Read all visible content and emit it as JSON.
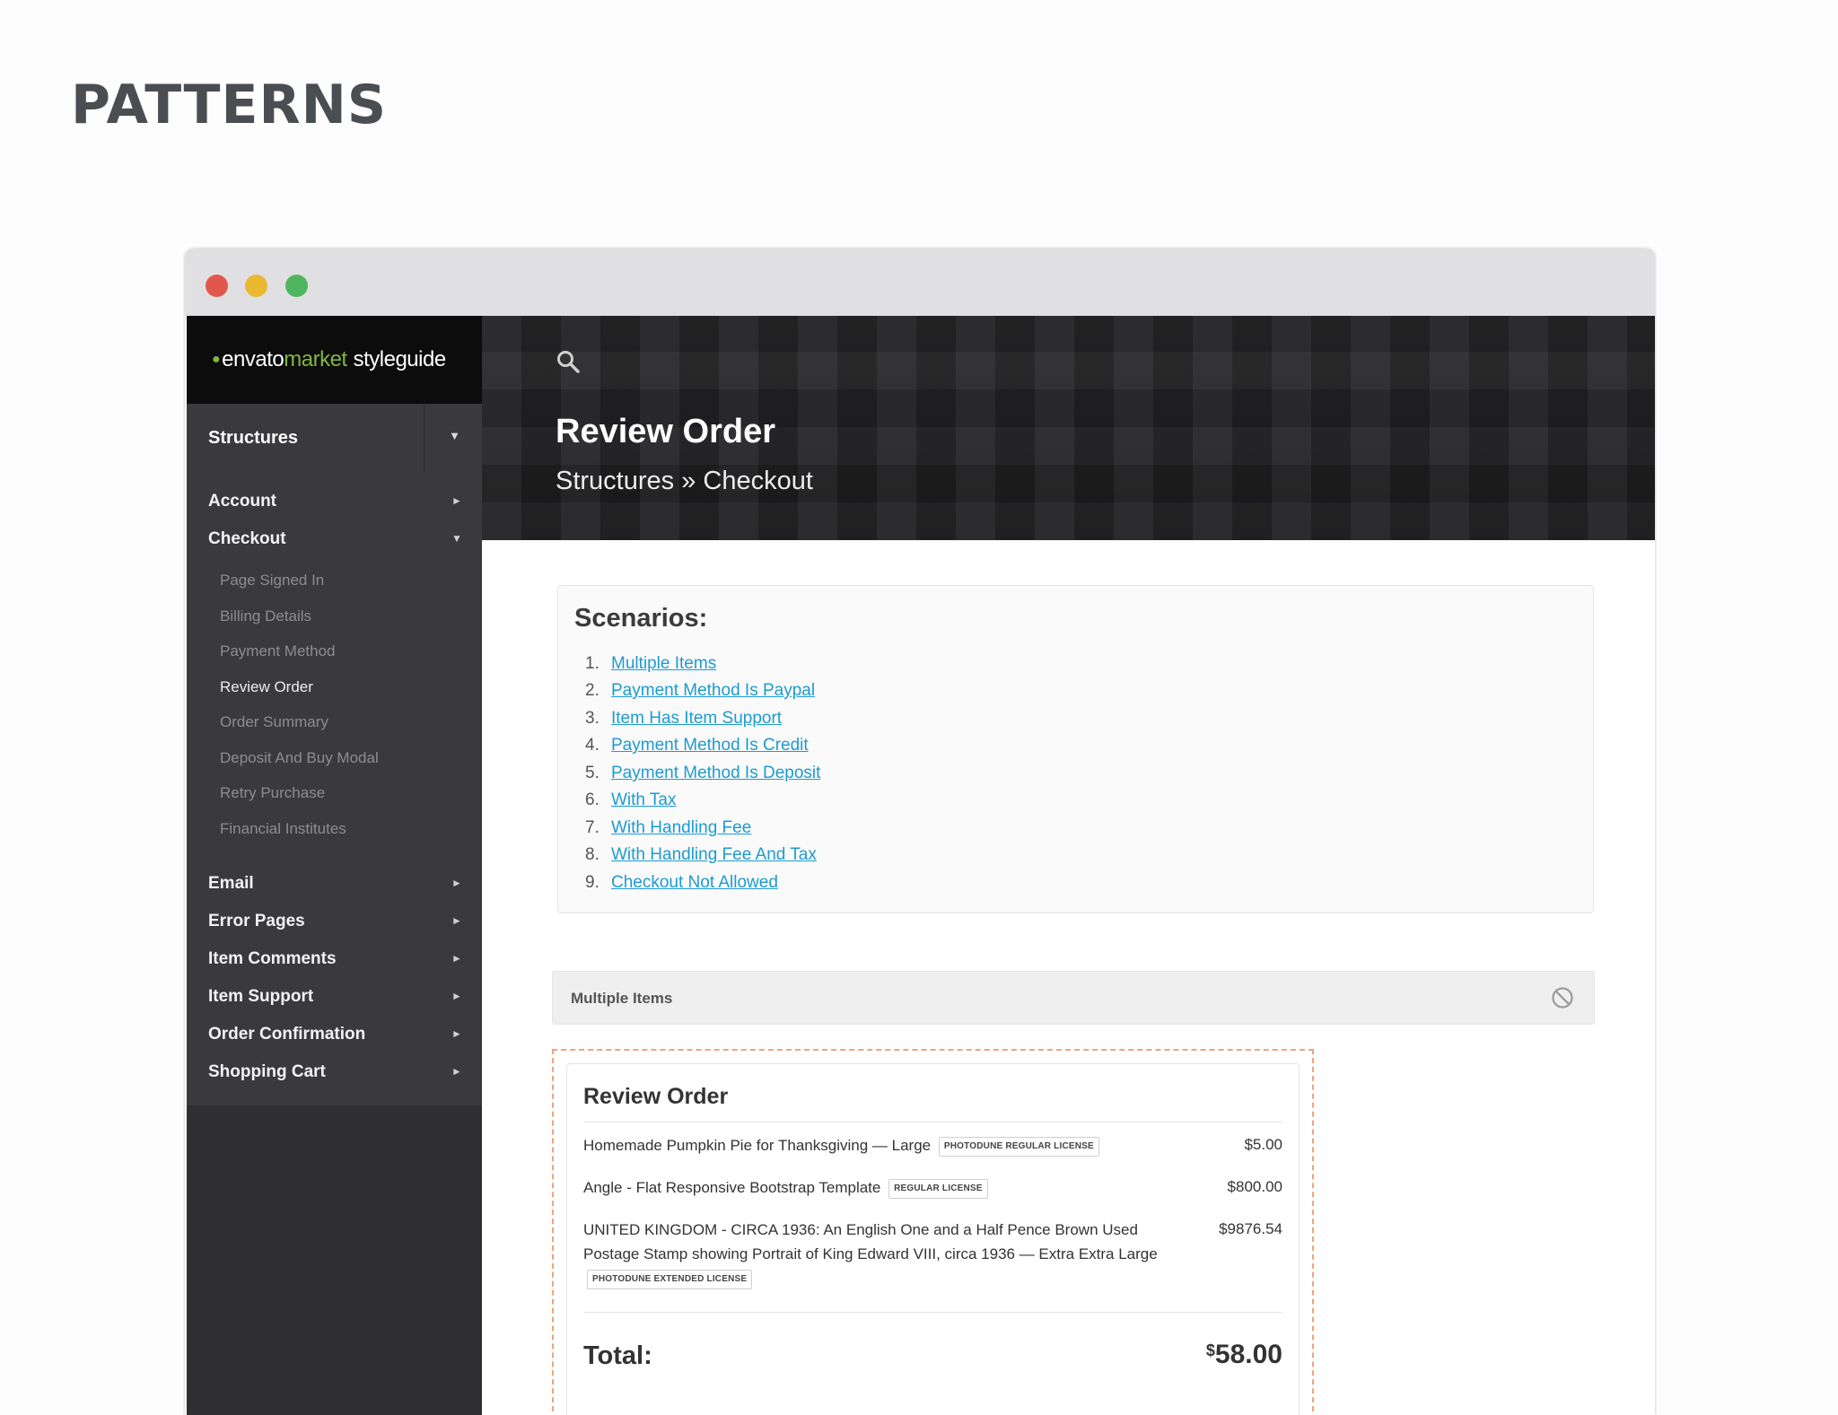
{
  "slide": {
    "title": "PATTERNS"
  },
  "window": {
    "controls": [
      "close",
      "minimize",
      "maximize"
    ]
  },
  "sidebar": {
    "brand": {
      "part1": "envato",
      "part2": "market",
      "part3": "styleguide"
    },
    "section": "Structures",
    "items": [
      {
        "label": "Account"
      },
      {
        "label": "Checkout"
      },
      {
        "label": "Email"
      },
      {
        "label": "Error Pages"
      },
      {
        "label": "Item Comments"
      },
      {
        "label": "Item Support"
      },
      {
        "label": "Order Confirmation"
      },
      {
        "label": "Shopping Cart"
      }
    ],
    "checkout_subitems": [
      {
        "label": "Page Signed In"
      },
      {
        "label": "Billing Details"
      },
      {
        "label": "Payment Method"
      },
      {
        "label": "Review Order"
      },
      {
        "label": "Order Summary"
      },
      {
        "label": "Deposit And Buy Modal"
      },
      {
        "label": "Retry Purchase"
      },
      {
        "label": "Financial Institutes"
      }
    ]
  },
  "hero": {
    "title": "Review Order",
    "breadcrumb": "Structures » Checkout"
  },
  "scenarios": {
    "heading": "Scenarios:",
    "items": [
      {
        "num": "1.",
        "label": "Multiple Items"
      },
      {
        "num": "2.",
        "label": "Payment Method Is Paypal"
      },
      {
        "num": "3.",
        "label": "Item Has Item Support"
      },
      {
        "num": "4.",
        "label": "Payment Method Is Credit"
      },
      {
        "num": "5.",
        "label": "Payment Method Is Deposit"
      },
      {
        "num": "6.",
        "label": "With Tax"
      },
      {
        "num": "7.",
        "label": "With Handling Fee"
      },
      {
        "num": "8.",
        "label": "With Handling Fee And Tax"
      },
      {
        "num": "9.",
        "label": "Checkout Not Allowed"
      }
    ]
  },
  "example": {
    "label": "Multiple Items"
  },
  "review": {
    "title": "Review Order",
    "items": [
      {
        "name": "Homemade Pumpkin Pie for Thanksgiving — Large",
        "license": "PHOTODUNE REGULAR LICENSE",
        "price": "$5.00"
      },
      {
        "name": "Angle - Flat Responsive Bootstrap Template",
        "license": "REGULAR LICENSE",
        "price": "$800.00"
      },
      {
        "name": "UNITED KINGDOM - CIRCA 1936: An English One and a Half Pence Brown Used Postage Stamp showing Portrait of King Edward VIII, circa 1936 — Extra Extra Large",
        "license": "PHOTODUNE EXTENDED LICENSE",
        "price": "$9876.54"
      }
    ],
    "total_label": "Total:",
    "total_currency": "$",
    "total_amount": "58.00"
  },
  "colors": {
    "brand_green": "#82b540",
    "link": "#1d9bd1",
    "dashed_border": "#f0a47a",
    "sidebar_bg": "#3a3a3c"
  },
  "icons": [
    "search-icon",
    "chevron-down-icon",
    "chevron-right-icon",
    "ban-icon",
    "leaf-icon"
  ]
}
